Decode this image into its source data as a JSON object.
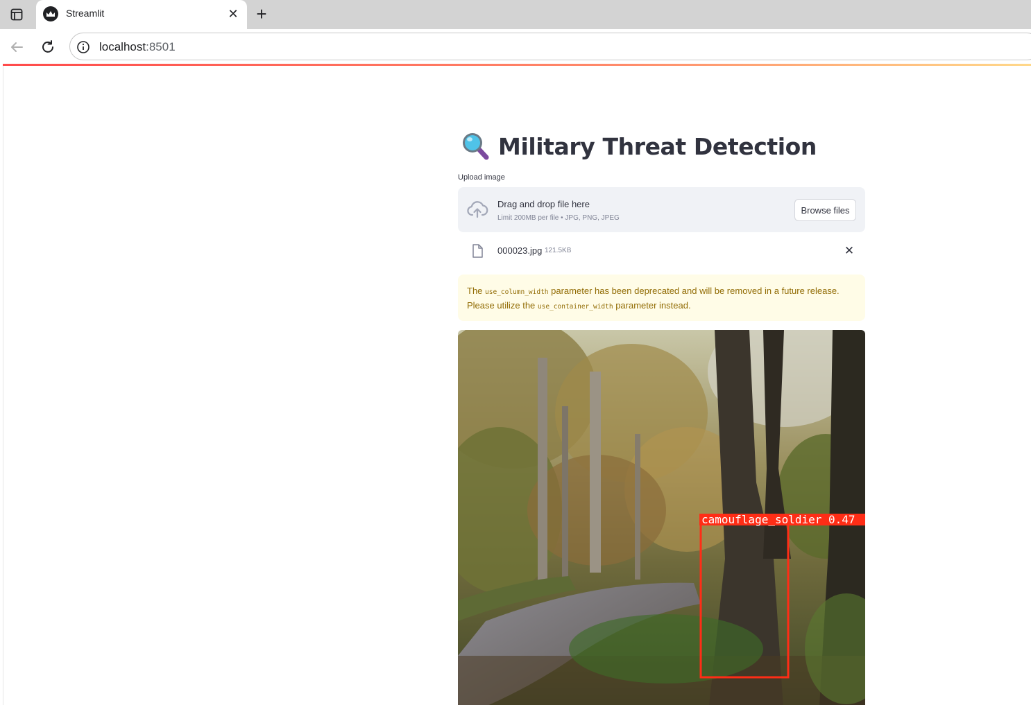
{
  "browser": {
    "tab_title": "Streamlit",
    "url_host": "localhost",
    "url_port": ":8501"
  },
  "page": {
    "title": "Military Threat Detection",
    "title_icon": "magnifying-glass-emoji"
  },
  "uploader": {
    "label": "Upload image",
    "drop_title": "Drag and drop file here",
    "drop_subtitle": "Limit 200MB per file • JPG, PNG, JPEG",
    "browse_label": "Browse files",
    "file_name": "000023.jpg",
    "file_size": "121.5KB"
  },
  "warning": {
    "text_before": "The ",
    "code1": "use_column_width",
    "text_middle": " parameter has been deprecated and will be removed in a future release. Please utilize the ",
    "code2": "use_container_width",
    "text_after": " parameter instead."
  },
  "detection": {
    "label": "camouflage_soldier 0.47",
    "box_color": "#ff2d16"
  },
  "colors": {
    "accent": "#ff4b4b",
    "text": "#31333f",
    "warning_text": "#926c05",
    "warning_bg": "#fffce7"
  }
}
